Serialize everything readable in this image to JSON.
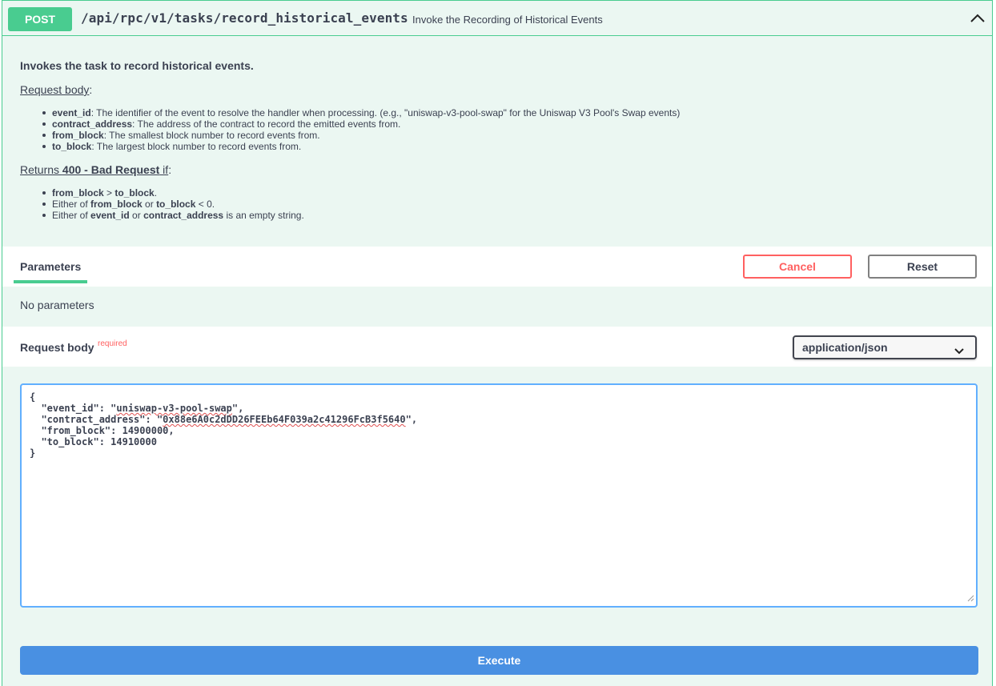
{
  "summary": {
    "method": "POST",
    "path": "/api/rpc/v1/tasks/record_historical_events",
    "description": "Invoke the Recording of Historical Events",
    "collapse_icon": "chevron-up-icon"
  },
  "description": {
    "title": "Invokes the task to record historical events.",
    "request_body_heading": "Request body",
    "request_body_items": [
      {
        "term": "event_id",
        "text": ": The identifier of the event to resolve the handler when processing. (e.g., \"uniswap-v3-pool-swap\" for the Uniswap V3 Pool's Swap events)"
      },
      {
        "term": "contract_address",
        "text": ": The address of the contract to record the emitted events from."
      },
      {
        "term": "from_block",
        "text": ": The smallest block number to record events from."
      },
      {
        "term": "to_block",
        "text": ": The largest block number to record events from."
      }
    ],
    "returns_prefix": "Returns ",
    "returns_code": "400 - Bad Request",
    "returns_suffix": " if",
    "errors": {
      "e1_a": "from_block",
      "e1_b": " > ",
      "e1_c": "to_block",
      "e1_d": ".",
      "e2_a": "Either of ",
      "e2_b": "from_block",
      "e2_c": " or ",
      "e2_d": "to_block",
      "e2_e": " < 0.",
      "e3_a": "Either of ",
      "e3_b": "event_id",
      "e3_c": " or ",
      "e3_d": "contract_address",
      "e3_e": " is an empty string."
    }
  },
  "parameters": {
    "tab_label": "Parameters",
    "cancel_label": "Cancel",
    "reset_label": "Reset",
    "empty_text": "No parameters"
  },
  "request_body": {
    "label": "Request body",
    "required_label": "required",
    "content_type": "application/json",
    "json": {
      "line_open": "{",
      "event_id_key": "  \"event_id\": \"",
      "event_id_val": "uniswap-v3-pool-swap",
      "event_id_end": "\",",
      "contract_key": "  \"contract_address\": \"",
      "contract_val": "0x88e6A0c2dDD26FEEb64F039a2c41296FcB3f5640",
      "contract_end": "\",",
      "from_block_line": "  \"from_block\": 14900000,",
      "to_block_line": "  \"to_block\": 14910000",
      "line_close": "}"
    }
  },
  "execute_label": "Execute",
  "colors": {
    "post_green": "#49cc90",
    "post_bg": "#ebf7f2",
    "execute_blue": "#4990e2",
    "cancel_red": "#ff6060"
  }
}
